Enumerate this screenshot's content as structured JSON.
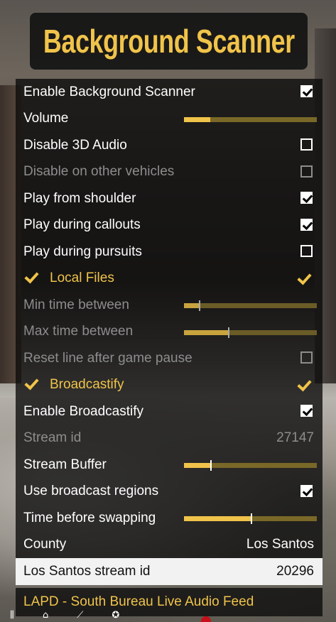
{
  "title": "Background Scanner",
  "colors": {
    "accent": "#f0c34a",
    "panel": "#0a0a0a",
    "highlight": "#f2f2f2",
    "disabled": "#8d8d8d"
  },
  "rows": [
    {
      "label": "Enable Background Scanner",
      "kind": "checkbox",
      "checked": true,
      "disabled": false
    },
    {
      "label": "Volume",
      "kind": "slider",
      "level": 0.2,
      "disabled": false
    },
    {
      "label": "Disable 3D Audio",
      "kind": "checkbox",
      "checked": false,
      "disabled": false
    },
    {
      "label": "Disable on other vehicles",
      "kind": "checkbox",
      "checked": false,
      "disabled": true
    },
    {
      "label": "Play from shoulder",
      "kind": "checkbox",
      "checked": true,
      "disabled": false
    },
    {
      "label": "Play during callouts",
      "kind": "checkbox",
      "checked": true,
      "disabled": false
    },
    {
      "label": "Play during pursuits",
      "kind": "checkbox",
      "checked": false,
      "disabled": false
    },
    {
      "label": "Local Files",
      "kind": "header",
      "checked": true
    },
    {
      "label": "Min time between",
      "kind": "slider",
      "level": 0.11,
      "disabled": true
    },
    {
      "label": "Max time between",
      "kind": "slider",
      "level": 0.33,
      "disabled": true
    },
    {
      "label": "Reset line after game pause",
      "kind": "checkbox",
      "checked": false,
      "disabled": true
    },
    {
      "label": "Broadcastify",
      "kind": "header",
      "checked": true
    },
    {
      "label": "Enable Broadcastify",
      "kind": "checkbox",
      "checked": true,
      "disabled": false
    },
    {
      "label": "Stream id",
      "kind": "value",
      "value": "27147",
      "disabled": true
    },
    {
      "label": "Stream Buffer",
      "kind": "slider",
      "level": 0.2,
      "disabled": false
    },
    {
      "label": "Use broadcast regions",
      "kind": "checkbox",
      "checked": true,
      "disabled": false
    },
    {
      "label": "Time before swapping",
      "kind": "slider",
      "level": 0.5,
      "disabled": false
    },
    {
      "label": "County",
      "kind": "value",
      "value": "Los Santos",
      "disabled": false
    },
    {
      "label": "Los Santos stream id",
      "kind": "value",
      "value": "20296",
      "disabled": false,
      "selected": true
    }
  ],
  "footer": "LAPD - South Bureau Live Audio Feed",
  "bottom_icons": [
    "bars-icon",
    "home-icon",
    "chart-icon",
    "badge-icon"
  ]
}
